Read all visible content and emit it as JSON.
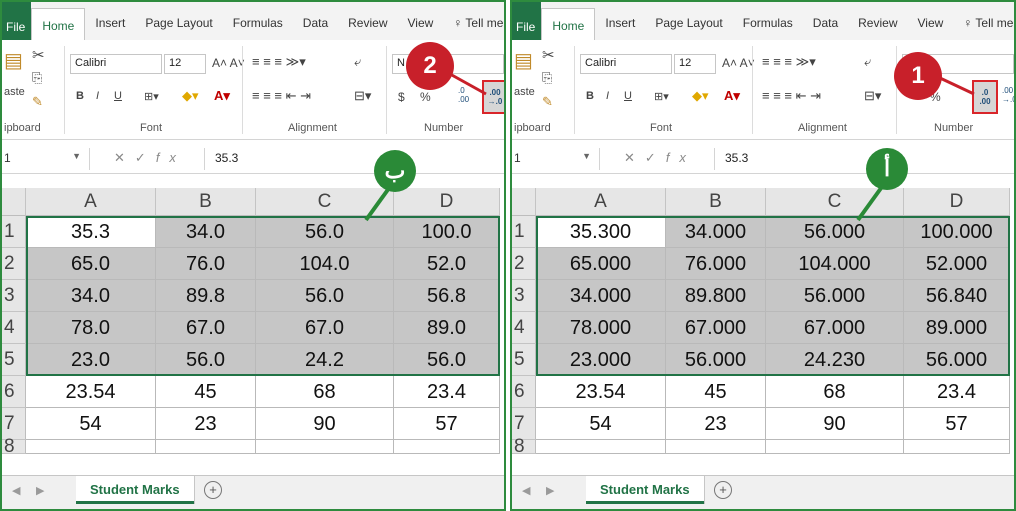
{
  "ribbon_tabs": [
    "File",
    "Home",
    "Insert",
    "Page Layout",
    "Formulas",
    "Data",
    "Review",
    "View"
  ],
  "tell_me": "Tell me",
  "clipboard_label": "ipboard",
  "paste_label": "aste",
  "font_label": "Font",
  "alignment_label": "Alignment",
  "number_label": "Number",
  "font_name": "Calibri",
  "font_size": "12",
  "bold": "B",
  "italic": "I",
  "underline": "U",
  "dollar": "$",
  "percent": "%",
  "number_format_left": "N",
  "inc_decimal": [
    ".0",
    ".00"
  ],
  "dec_decimal": [
    ".00",
    "→.0"
  ],
  "name_box": "1",
  "fx": "fx",
  "formula_value": "35.3",
  "columns": [
    "A",
    "B",
    "C",
    "D"
  ],
  "rows": [
    "1",
    "2",
    "3",
    "4",
    "5",
    "6",
    "7",
    "8"
  ],
  "sheet_tab": "Student Marks",
  "add_sheet": "+",
  "left_panel": {
    "callout_step": "2",
    "callout_label": "ب",
    "cells": [
      [
        "35.3",
        "34.0",
        "56.0",
        "100.0"
      ],
      [
        "65.0",
        "76.0",
        "104.0",
        "52.0"
      ],
      [
        "34.0",
        "89.8",
        "56.0",
        "56.8"
      ],
      [
        "78.0",
        "67.0",
        "67.0",
        "89.0"
      ],
      [
        "23.0",
        "56.0",
        "24.2",
        "56.0"
      ],
      [
        "23.54",
        "45",
        "68",
        "23.4"
      ],
      [
        "54",
        "23",
        "90",
        "57"
      ]
    ]
  },
  "right_panel": {
    "callout_step": "1",
    "callout_label": "أ",
    "cells": [
      [
        "35.300",
        "34.000",
        "56.000",
        "100.000"
      ],
      [
        "65.000",
        "76.000",
        "104.000",
        "52.000"
      ],
      [
        "34.000",
        "89.800",
        "56.000",
        "56.840"
      ],
      [
        "78.000",
        "67.000",
        "67.000",
        "89.000"
      ],
      [
        "23.000",
        "56.000",
        "24.230",
        "56.000"
      ],
      [
        "23.54",
        "45",
        "68",
        "23.4"
      ],
      [
        "54",
        "23",
        "90",
        "57"
      ]
    ]
  },
  "colors": {
    "excel_green": "#217346",
    "callout_red": "#c8202a",
    "callout_green": "#2a8a37",
    "selection_fill": "#c6c6c6"
  }
}
